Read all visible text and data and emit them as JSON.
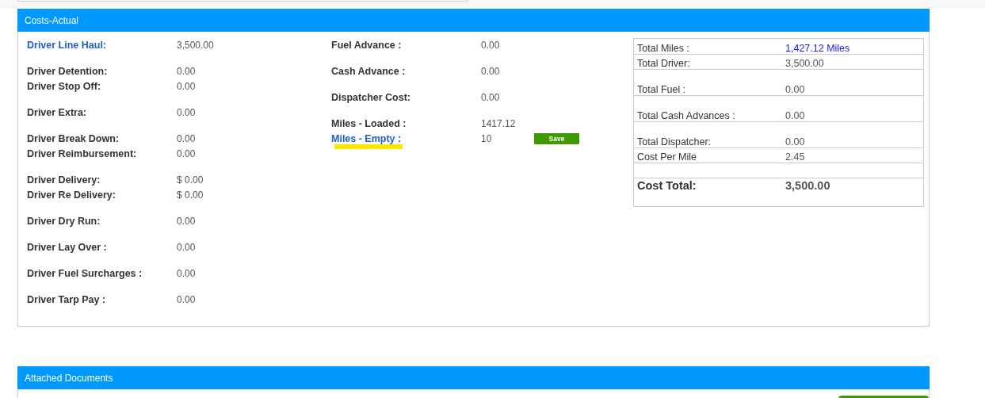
{
  "costs_panel": {
    "title": "Costs-Actual",
    "left_groups": [
      {
        "rows": [
          {
            "label": "Driver Line Haul:",
            "value": "3,500.00",
            "kind": "link"
          }
        ]
      },
      {
        "rows": [
          {
            "label": "Driver Detention:",
            "value": "0.00",
            "kind": "label"
          },
          {
            "label": "Driver Stop Off:",
            "value": "0.00",
            "kind": "label"
          }
        ]
      },
      {
        "rows": [
          {
            "label": "Driver Extra:",
            "value": "0.00",
            "kind": "label"
          }
        ]
      },
      {
        "rows": [
          {
            "label": "Driver Break Down:",
            "value": "0.00",
            "kind": "label"
          },
          {
            "label": "Driver Reimbursement:",
            "value": "0.00",
            "kind": "label"
          }
        ]
      },
      {
        "rows": [
          {
            "label": "Driver Delivery:",
            "value": "$ 0.00",
            "kind": "label"
          },
          {
            "label": "Driver Re Delivery:",
            "value": "$ 0.00",
            "kind": "label"
          }
        ]
      },
      {
        "rows": [
          {
            "label": "Driver Dry Run:",
            "value": "0.00",
            "kind": "label"
          }
        ]
      },
      {
        "rows": [
          {
            "label": "Driver Lay Over :",
            "value": "0.00",
            "kind": "label"
          }
        ]
      },
      {
        "rows": [
          {
            "label": "Driver Fuel Surcharges :",
            "value": "0.00",
            "kind": "label"
          }
        ]
      },
      {
        "rows": [
          {
            "label": "Driver Tarp Pay :",
            "value": "0.00",
            "kind": "label"
          }
        ]
      }
    ],
    "middle_groups": [
      {
        "rows": [
          {
            "label": "Fuel Advance :",
            "value": "0.00",
            "kind": "label",
            "highlighted": false
          }
        ]
      },
      {
        "rows": [
          {
            "label": "Cash Advance :",
            "value": "0.00",
            "kind": "label",
            "highlighted": false
          }
        ]
      },
      {
        "rows": [
          {
            "label": "Dispatcher Cost:",
            "value": "0.00",
            "kind": "label",
            "highlighted": false
          }
        ]
      },
      {
        "rows": [
          {
            "label": "Miles - Loaded :",
            "value": "1417.12",
            "kind": "label",
            "highlighted": false
          },
          {
            "label": "Miles - Empty :",
            "value": "10",
            "kind": "link",
            "highlighted": true,
            "button": "Save"
          }
        ]
      }
    ],
    "totals": [
      {
        "kind": "short",
        "label": "Total Miles :",
        "value": "1,427.12 Miles",
        "value_link": true
      },
      {
        "kind": "short",
        "label": "Total Driver:",
        "value": "3,500.00",
        "value_link": false
      },
      {
        "kind": "tall",
        "label": "Total Fuel :",
        "value": "0.00",
        "value_link": false
      },
      {
        "kind": "tall",
        "label": "Total Cash Advances :",
        "value": "0.00",
        "value_link": false
      },
      {
        "kind": "tall",
        "label": "Total Dispatcher:",
        "value": "0.00",
        "value_link": false
      },
      {
        "kind": "short",
        "label": "Cost Per Mile",
        "value": "2.45",
        "value_link": false
      },
      {
        "kind": "blank"
      },
      {
        "kind": "total",
        "label": "Cost Total:",
        "value": "3,500.00",
        "value_link": false
      }
    ]
  },
  "documents_panel": {
    "title": "Attached Documents"
  }
}
